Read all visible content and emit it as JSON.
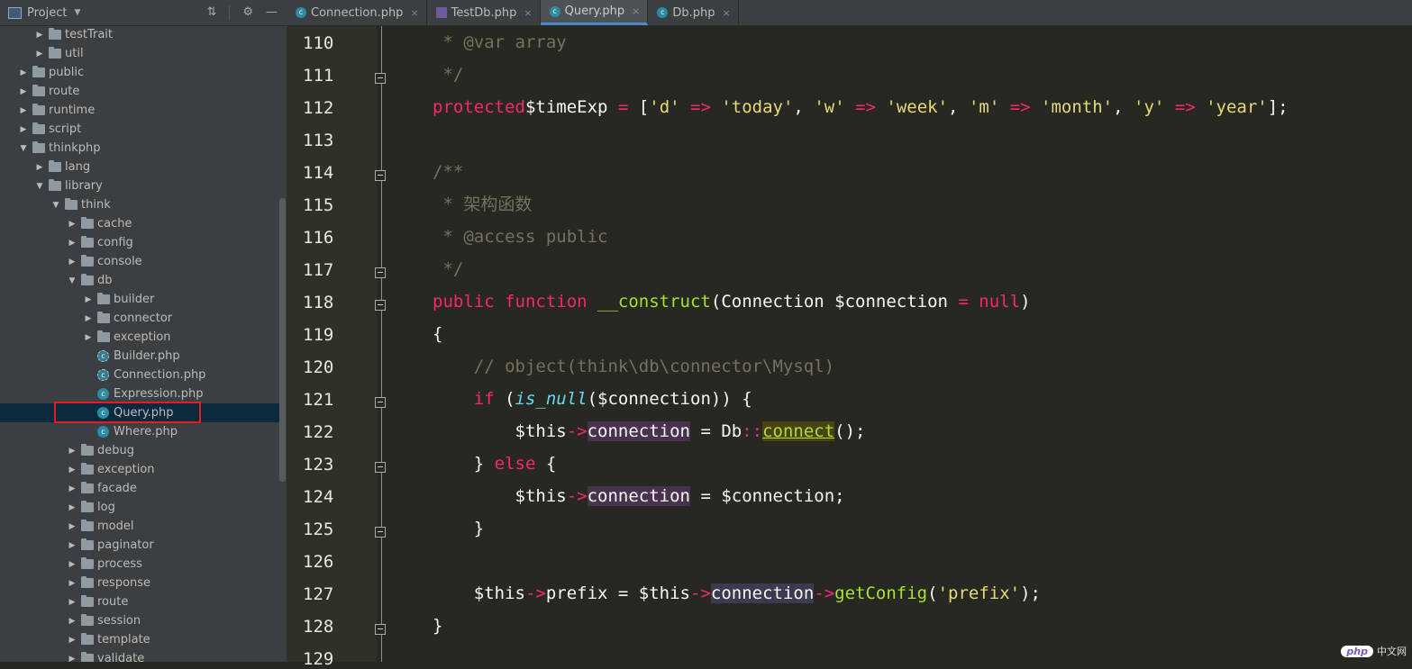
{
  "sidebar": {
    "title": "Project",
    "tree": [
      {
        "label": "testTrait",
        "kind": "folder",
        "level": 2,
        "expanded": false
      },
      {
        "label": "util",
        "kind": "folder",
        "level": 2,
        "expanded": false
      },
      {
        "label": "public",
        "kind": "folder",
        "level": 1,
        "expanded": false
      },
      {
        "label": "route",
        "kind": "folder",
        "level": 1,
        "expanded": false
      },
      {
        "label": "runtime",
        "kind": "folder",
        "level": 1,
        "expanded": false
      },
      {
        "label": "script",
        "kind": "folder",
        "level": 1,
        "expanded": false
      },
      {
        "label": "thinkphp",
        "kind": "folder",
        "level": 1,
        "expanded": true
      },
      {
        "label": "lang",
        "kind": "folder",
        "level": 2,
        "expanded": false
      },
      {
        "label": "library",
        "kind": "folder",
        "level": 2,
        "expanded": true
      },
      {
        "label": "think",
        "kind": "folder",
        "level": 3,
        "expanded": true
      },
      {
        "label": "cache",
        "kind": "folder",
        "level": 4,
        "expanded": false
      },
      {
        "label": "config",
        "kind": "folder",
        "level": 4,
        "expanded": false
      },
      {
        "label": "console",
        "kind": "folder",
        "level": 4,
        "expanded": false
      },
      {
        "label": "db",
        "kind": "folder",
        "level": 4,
        "expanded": true
      },
      {
        "label": "builder",
        "kind": "folder",
        "level": 5,
        "expanded": false
      },
      {
        "label": "connector",
        "kind": "folder",
        "level": 5,
        "expanded": false
      },
      {
        "label": "exception",
        "kind": "folder",
        "level": 5,
        "expanded": false
      },
      {
        "label": "Builder.php",
        "kind": "abstract",
        "level": 5
      },
      {
        "label": "Connection.php",
        "kind": "abstract",
        "level": 5
      },
      {
        "label": "Expression.php",
        "kind": "class",
        "level": 5
      },
      {
        "label": "Query.php",
        "kind": "class",
        "level": 5,
        "selected": true
      },
      {
        "label": "Where.php",
        "kind": "class",
        "level": 5
      },
      {
        "label": "debug",
        "kind": "folder",
        "level": 4,
        "expanded": false
      },
      {
        "label": "exception",
        "kind": "folder",
        "level": 4,
        "expanded": false
      },
      {
        "label": "facade",
        "kind": "folder",
        "level": 4,
        "expanded": false
      },
      {
        "label": "log",
        "kind": "folder",
        "level": 4,
        "expanded": false
      },
      {
        "label": "model",
        "kind": "folder",
        "level": 4,
        "expanded": false
      },
      {
        "label": "paginator",
        "kind": "folder",
        "level": 4,
        "expanded": false
      },
      {
        "label": "process",
        "kind": "folder",
        "level": 4,
        "expanded": false
      },
      {
        "label": "response",
        "kind": "folder",
        "level": 4,
        "expanded": false
      },
      {
        "label": "route",
        "kind": "folder",
        "level": 4,
        "expanded": false
      },
      {
        "label": "session",
        "kind": "folder",
        "level": 4,
        "expanded": false
      },
      {
        "label": "template",
        "kind": "folder",
        "level": 4,
        "expanded": false
      },
      {
        "label": "validate",
        "kind": "folder",
        "level": 4,
        "expanded": false
      }
    ]
  },
  "tabs": [
    {
      "label": "Connection.php",
      "icon": "class",
      "active": false
    },
    {
      "label": "TestDb.php",
      "icon": "php",
      "active": false
    },
    {
      "label": "Query.php",
      "icon": "class",
      "active": true
    },
    {
      "label": "Db.php",
      "icon": "class",
      "active": false
    }
  ],
  "editor": {
    "lines": [
      {
        "n": "110",
        "fold": false,
        "code": [
          [
            "cmt",
            " * @var array"
          ]
        ]
      },
      {
        "n": "111",
        "fold": true,
        "code": [
          [
            "cmt",
            " */"
          ]
        ]
      },
      {
        "n": "112",
        "fold": false,
        "code": [
          [
            "kw",
            "protected"
          ],
          [
            "",
            "$timeExp "
          ],
          [
            "kw",
            "="
          ],
          [
            "",
            " ["
          ],
          [
            "str",
            "'d'"
          ],
          [
            "kw",
            " => "
          ],
          [
            "str",
            "'today'"
          ],
          [
            "",
            ", "
          ],
          [
            "str",
            "'w'"
          ],
          [
            "kw",
            " => "
          ],
          [
            "str",
            "'week'"
          ],
          [
            "",
            ", "
          ],
          [
            "str",
            "'m'"
          ],
          [
            "kw",
            " => "
          ],
          [
            "str",
            "'month'"
          ],
          [
            "",
            ", "
          ],
          [
            "str",
            "'y'"
          ],
          [
            "kw",
            " => "
          ],
          [
            "str",
            "'year'"
          ],
          [
            "",
            "];"
          ]
        ]
      },
      {
        "n": "113",
        "fold": false,
        "code": []
      },
      {
        "n": "114",
        "fold": true,
        "code": [
          [
            "cmt",
            "/**"
          ]
        ]
      },
      {
        "n": "115",
        "fold": false,
        "code": [
          [
            "cmt",
            " * 架构函数"
          ]
        ]
      },
      {
        "n": "116",
        "fold": false,
        "code": [
          [
            "cmt",
            " * @access public"
          ]
        ]
      },
      {
        "n": "117",
        "fold": true,
        "code": [
          [
            "cmt",
            " */"
          ]
        ]
      },
      {
        "n": "118",
        "fold": true,
        "code": [
          [
            "kw",
            "public function "
          ],
          [
            "fn",
            "__construct"
          ],
          [
            "",
            "(Connection $connection "
          ],
          [
            "kw",
            "= null"
          ],
          [
            "",
            ")"
          ]
        ]
      },
      {
        "n": "119",
        "fold": false,
        "code": [
          [
            "",
            "{"
          ]
        ]
      },
      {
        "n": "120",
        "fold": false,
        "code": [
          [
            "cmt",
            "    // object(think\\db\\connector\\Mysql)"
          ]
        ]
      },
      {
        "n": "121",
        "fold": true,
        "code": [
          [
            "kw",
            "    if "
          ],
          [
            "",
            "("
          ],
          [
            "italic-fn",
            "is_null"
          ],
          [
            "",
            "($connection)) {"
          ]
        ]
      },
      {
        "n": "122",
        "fold": false,
        "code": [
          [
            "",
            "        $this"
          ],
          [
            "kw",
            "->"
          ],
          [
            "var-bg",
            "connection"
          ],
          [
            "",
            " = Db"
          ],
          [
            "kw",
            "::"
          ],
          [
            "conn-hl",
            "connect"
          ],
          [
            "",
            "();"
          ]
        ]
      },
      {
        "n": "123",
        "fold": true,
        "code": [
          [
            "",
            "    } "
          ],
          [
            "kw",
            "else"
          ],
          [
            "",
            " {"
          ]
        ]
      },
      {
        "n": "124",
        "fold": false,
        "code": [
          [
            "",
            "        $this"
          ],
          [
            "kw",
            "->"
          ],
          [
            "var-bg",
            "connection"
          ],
          [
            "",
            " = $connection;"
          ]
        ]
      },
      {
        "n": "125",
        "fold": true,
        "code": [
          [
            "",
            "    }"
          ]
        ]
      },
      {
        "n": "126",
        "fold": false,
        "code": []
      },
      {
        "n": "127",
        "fold": false,
        "code": [
          [
            "",
            "    $this"
          ],
          [
            "kw",
            "->"
          ],
          [
            "",
            "prefix = $this"
          ],
          [
            "kw",
            "->"
          ],
          [
            "var-bg2",
            "connection"
          ],
          [
            "kw",
            "->"
          ],
          [
            "fn",
            "getConfig"
          ],
          [
            "",
            "("
          ],
          [
            "str",
            "'prefix'"
          ],
          [
            "",
            ");"
          ]
        ]
      },
      {
        "n": "128",
        "fold": true,
        "code": [
          [
            "",
            "}"
          ]
        ]
      },
      {
        "n": "129",
        "fold": false,
        "code": []
      }
    ]
  },
  "watermark": {
    "logo": "php",
    "text": "中文网"
  }
}
